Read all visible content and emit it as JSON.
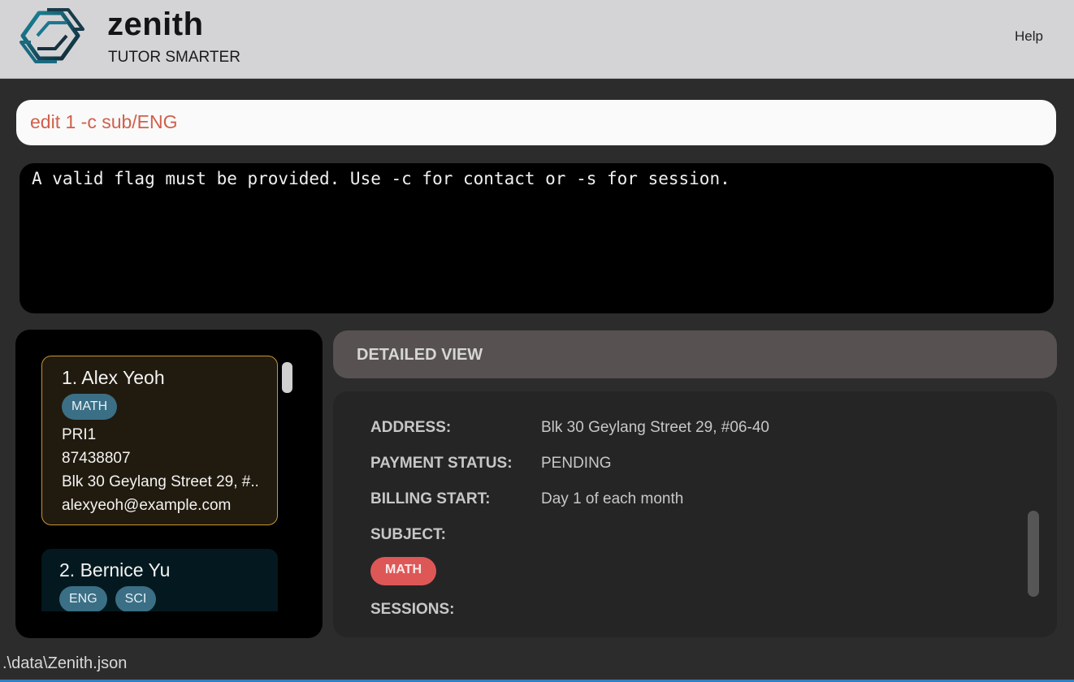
{
  "header": {
    "logo_icon": "zenith-logo-icon",
    "app_name": "zenith",
    "tagline": "TUTOR SMARTER",
    "help_label": "Help"
  },
  "command": {
    "value": "edit 1 -c sub/ENG"
  },
  "result": {
    "text": "A valid flag must be provided. Use -c for contact or -s for session."
  },
  "contacts": [
    {
      "name": "1. Alex Yeoh",
      "tags": [
        "MATH"
      ],
      "level": "PRI1",
      "phone": "87438807",
      "address": "Blk 30 Geylang Street 29, #...",
      "email": "alexyeoh@example.com"
    },
    {
      "name": "2. Bernice Yu",
      "tags": [
        "ENG",
        "SCI"
      ]
    }
  ],
  "detail": {
    "title": "DETAILED VIEW",
    "address_label": "ADDRESS:",
    "address_value": "Blk 30 Geylang Street 29, #06-40",
    "payment_label": "PAYMENT STATUS:",
    "payment_value": "PENDING",
    "billing_label": "BILLING START:",
    "billing_value": "Day 1 of each month",
    "subject_label": "SUBJECT:",
    "subject_tag": "MATH",
    "sessions_label": "SESSIONS:"
  },
  "status_bar": {
    "path": ".\\data\\Zenith.json"
  },
  "colors": {
    "header_bg": "#d4d4d6",
    "command_text": "#d0604a",
    "selected_card_border": "#c79634",
    "contact_tag_bg": "#3b6f85",
    "subject_tag_bg": "#de5757"
  }
}
